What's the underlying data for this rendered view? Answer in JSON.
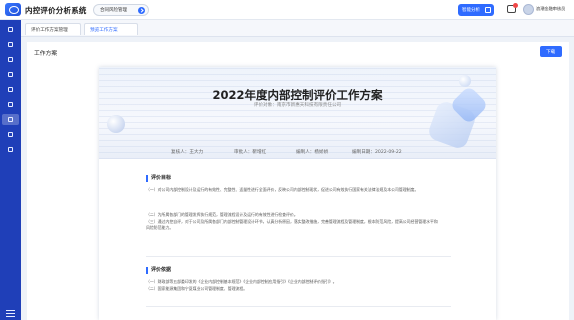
{
  "header": {
    "app_title": "内控评价分析系统",
    "module_select": "合同风险管理",
    "analysis_button": "智能分析",
    "user_name": "浪潮金融审核员"
  },
  "tabs": [
    {
      "label": "评价工作方案管理"
    },
    {
      "label": "预览工作方案"
    }
  ],
  "main": {
    "title": "工作方案",
    "export_label": "下载"
  },
  "document": {
    "title": "2022年度内部控制评价工作方案",
    "subject": "评价对象：南京市新惠天科技有限责任公司",
    "meta": {
      "reviewer": "复核人：王大力",
      "approver": "审批人：靳增红",
      "editor": "编制人：杨娇娇",
      "date": "编制日期：2022-09-22"
    },
    "sections": [
      {
        "heading": "评价目标",
        "paragraphs": [
          "（一）对公司内部控制设计及运行的有效性、完整性、适量性进行全面评价，反映公司内部控制现状，促进公司有效执行国家有关法律法规及本公司管理制度。",
          "（二）为所属各部门的管理发挥执行规范，管理流程设计及运行的有效性进行检查评价。",
          "（三）通过内控自评，对于公司及所属各部门内部控制管理设计环节，认真分析原因，落实整改措施，完善管理流程及管理制度，根本防范风险，提高公司经营管理水平和风险防范能力。"
        ]
      },
      {
        "heading": "评价依据",
        "paragraphs": [
          "（一）财政部等五部委印发的《企业内部控制基本规范》《企业内部控制应用指引》《企业内部控制评价指引》。",
          "（二）国家能源集团和宁夏煤业公司管理制度、管理流程。"
        ]
      }
    ]
  },
  "colors": {
    "primary": "#2f6bff",
    "sidebar": "#1f3fb8"
  }
}
